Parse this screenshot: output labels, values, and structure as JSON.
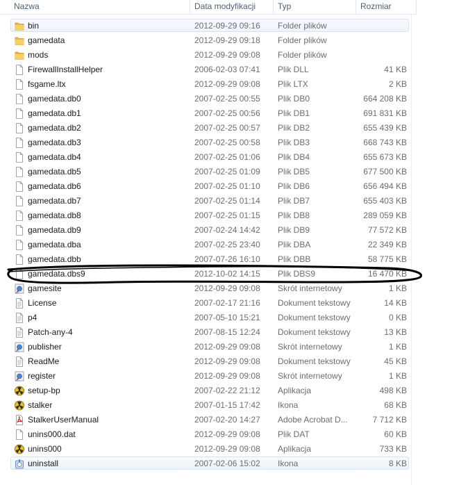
{
  "header": {
    "name": "Nazwa",
    "date": "Data modyfikacji",
    "type": "Typ",
    "size": "Rozmiar"
  },
  "files": [
    {
      "name": "bin",
      "date": "2012-09-29 09:16",
      "type": "Folder plików",
      "size": "",
      "icon": "folder-icon"
    },
    {
      "name": "gamedata",
      "date": "2012-09-29 09:18",
      "type": "Folder plików",
      "size": "",
      "icon": "folder-icon"
    },
    {
      "name": "mods",
      "date": "2012-09-29 09:08",
      "type": "Folder plików",
      "size": "",
      "icon": "folder-icon"
    },
    {
      "name": "FirewallInstallHelper",
      "date": "2006-02-03 07:41",
      "type": "Plik DLL",
      "size": "41 KB",
      "icon": "file-icon"
    },
    {
      "name": "fsgame.ltx",
      "date": "2012-09-29 09:08",
      "type": "Plik LTX",
      "size": "2 KB",
      "icon": "file-icon"
    },
    {
      "name": "gamedata.db0",
      "date": "2007-02-25 00:55",
      "type": "Plik DB0",
      "size": "664 208 KB",
      "icon": "file-icon"
    },
    {
      "name": "gamedata.db1",
      "date": "2007-02-25 00:56",
      "type": "Plik DB1",
      "size": "691 831 KB",
      "icon": "file-icon"
    },
    {
      "name": "gamedata.db2",
      "date": "2007-02-25 00:57",
      "type": "Plik DB2",
      "size": "655 439 KB",
      "icon": "file-icon"
    },
    {
      "name": "gamedata.db3",
      "date": "2007-02-25 00:58",
      "type": "Plik DB3",
      "size": "668 743 KB",
      "icon": "file-icon"
    },
    {
      "name": "gamedata.db4",
      "date": "2007-02-25 01:06",
      "type": "Plik DB4",
      "size": "655 673 KB",
      "icon": "file-icon"
    },
    {
      "name": "gamedata.db5",
      "date": "2007-02-25 01:09",
      "type": "Plik DB5",
      "size": "677 500 KB",
      "icon": "file-icon"
    },
    {
      "name": "gamedata.db6",
      "date": "2007-02-25 01:10",
      "type": "Plik DB6",
      "size": "656 494 KB",
      "icon": "file-icon"
    },
    {
      "name": "gamedata.db7",
      "date": "2007-02-25 01:14",
      "type": "Plik DB7",
      "size": "655 403 KB",
      "icon": "file-icon"
    },
    {
      "name": "gamedata.db8",
      "date": "2007-02-25 01:15",
      "type": "Plik DB8",
      "size": "289 059 KB",
      "icon": "file-icon"
    },
    {
      "name": "gamedata.db9",
      "date": "2007-02-24 14:42",
      "type": "Plik DB9",
      "size": "77 572 KB",
      "icon": "file-icon"
    },
    {
      "name": "gamedata.dba",
      "date": "2007-02-25 23:40",
      "type": "Plik DBA",
      "size": "22 349 KB",
      "icon": "file-icon"
    },
    {
      "name": "gamedata.dbb",
      "date": "2007-07-26 16:10",
      "type": "Plik DBB",
      "size": "58 775 KB",
      "icon": "file-icon"
    },
    {
      "name": "gamedata.dbs9",
      "date": "2012-10-02 14:15",
      "type": "Plik DBS9",
      "size": "16 470 KB",
      "icon": "file-icon"
    },
    {
      "name": "gamesite",
      "date": "2012-09-29 09:08",
      "type": "Skrót internetowy",
      "size": "1 KB",
      "icon": "internet-shortcut-icon"
    },
    {
      "name": "License",
      "date": "2007-02-17 21:16",
      "type": "Dokument tekstowy",
      "size": "14 KB",
      "icon": "text-document-icon"
    },
    {
      "name": "p4",
      "date": "2007-05-10 15:21",
      "type": "Dokument tekstowy",
      "size": "0 KB",
      "icon": "text-document-icon"
    },
    {
      "name": "Patch-any-4",
      "date": "2007-08-15 12:24",
      "type": "Dokument tekstowy",
      "size": "13 KB",
      "icon": "text-document-icon"
    },
    {
      "name": "publisher",
      "date": "2012-09-29 09:08",
      "type": "Skrót internetowy",
      "size": "1 KB",
      "icon": "internet-shortcut-icon"
    },
    {
      "name": "ReadMe",
      "date": "2012-09-29 09:08",
      "type": "Dokument tekstowy",
      "size": "45 KB",
      "icon": "text-document-icon"
    },
    {
      "name": "register",
      "date": "2012-09-29 09:08",
      "type": "Skrót internetowy",
      "size": "1 KB",
      "icon": "internet-shortcut-icon"
    },
    {
      "name": "setup-bp",
      "date": "2007-02-22 21:12",
      "type": "Aplikacja",
      "size": "498 KB",
      "icon": "radiation-icon"
    },
    {
      "name": "stalker",
      "date": "2007-01-15 17:42",
      "type": "Ikona",
      "size": "68 KB",
      "icon": "radiation-icon"
    },
    {
      "name": "StalkerUserManual",
      "date": "2007-02-20 14:27",
      "type": "Adobe Acrobat D...",
      "size": "7 712 KB",
      "icon": "pdf-icon"
    },
    {
      "name": "unins000.dat",
      "date": "2012-09-29 09:08",
      "type": "Plik DAT",
      "size": "60 KB",
      "icon": "file-icon"
    },
    {
      "name": "unins000",
      "date": "2012-09-29 09:08",
      "type": "Aplikacja",
      "size": "733 KB",
      "icon": "radiation-icon"
    },
    {
      "name": "uninstall",
      "date": "2007-02-06 15:02",
      "type": "Ikona",
      "size": "8 KB",
      "icon": "uninstall-icon"
    }
  ],
  "selected_rows": [
    0,
    30
  ],
  "highlighted_row": 17,
  "colors": {
    "folder": "#e8b84a",
    "selection_border": "#d6e1f2",
    "annotation_ink": "#000000"
  }
}
